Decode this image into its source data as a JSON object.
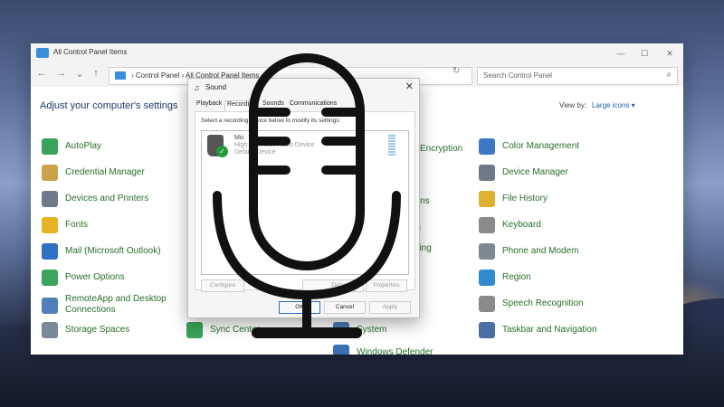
{
  "window": {
    "title": "All Control Panel Items",
    "controls": [
      "—",
      "☐",
      "✕"
    ]
  },
  "nav": {
    "back": "←",
    "forward": "→",
    "dropdown": "⌄",
    "up": "↑",
    "breadcrumb": "›  Control Panel  ›  All Control Panel Items",
    "refresh": "↻",
    "search_placeholder": "Search Control Panel",
    "search_icon": "⌕"
  },
  "heading": "Adjust your computer's settings",
  "view_by": {
    "label": "View by:",
    "value": "Large icons ▾"
  },
  "items_left": [
    {
      "label": "AutoPlay",
      "color": "#3aa35a"
    },
    {
      "label": "Credential Manager",
      "color": "#c9a24a"
    },
    {
      "label": "Devices and Printers",
      "color": "#6c7a89"
    },
    {
      "label": "Fonts",
      "color": "#e6b422"
    },
    {
      "label": "Mail (Microsoft Outlook)",
      "color": "#2f6fc4"
    },
    {
      "label": "Power Options",
      "color": "#3ca55c"
    },
    {
      "label": "RemoteApp and Desktop Connections",
      "color": "#4d7fb8"
    },
    {
      "label": "Storage Spaces",
      "color": "#7a8a99"
    }
  ],
  "items_mid_partial": [
    "Encryption",
    "ns",
    "ptions",
    "s",
    "haring"
  ],
  "items_mid_bottom": [
    {
      "label": "Sync Center",
      "color": "#3aa35a"
    },
    {
      "label": "System",
      "color": "#4b7bb5"
    },
    {
      "label": "Windows Defender",
      "color": "#3b6fb0"
    }
  ],
  "items_right": [
    {
      "label": "Color Management",
      "color": "#3b79c4"
    },
    {
      "label": "Device Manager",
      "color": "#6c7a89"
    },
    {
      "label": "File History",
      "color": "#e0b030"
    },
    {
      "label": "Keyboard",
      "color": "#8a8a8a"
    },
    {
      "label": "Phone and Modem",
      "color": "#7d8a96"
    },
    {
      "label": "Region",
      "color": "#2f8ad1"
    },
    {
      "label": "Speech Recognition",
      "color": "#8a8a8a"
    },
    {
      "label": "Taskbar and Navigation",
      "color": "#4b6fa5"
    }
  ],
  "sound": {
    "title": "Sound",
    "close": "✕",
    "tabs": [
      "Playback",
      "Recording",
      "Sounds",
      "Communications"
    ],
    "active_tab": 1,
    "instruction": "Select a recording device below to modify its settings:",
    "device": {
      "name": "Mic",
      "line1": "High Definition Audio Device",
      "line2": "Default Device"
    },
    "buttons": {
      "configure": "Configure",
      "set_default": "Default",
      "properties": "Properties",
      "ok": "OK",
      "cancel": "Cancel",
      "apply": "Apply"
    }
  }
}
